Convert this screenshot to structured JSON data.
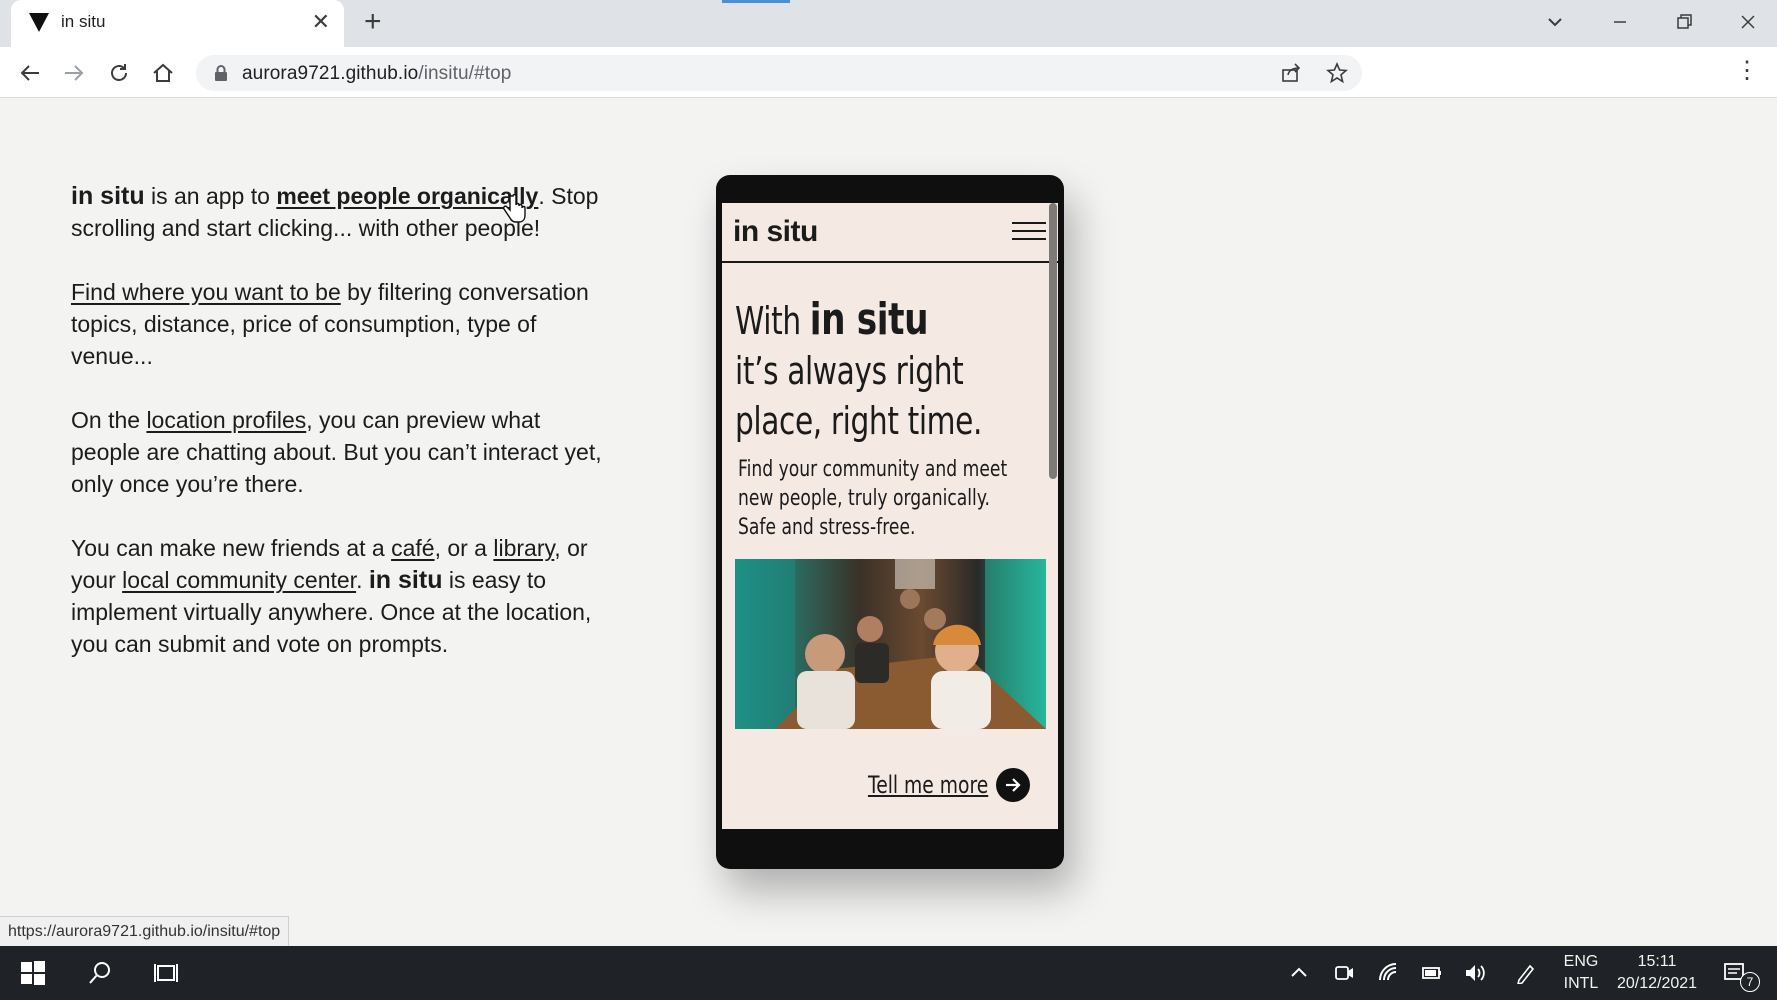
{
  "browser": {
    "tab_title": "in situ",
    "url_host": "aurora9721.github.io",
    "url_path": "/insitu/#top",
    "status_url": "https://aurora9721.github.io/insitu/#top",
    "accent_color": "#4a90d9"
  },
  "page": {
    "brand": "in situ",
    "p1": {
      "after_brand": " is an app to ",
      "link": "meet people organically",
      "rest": ". Stop scrolling and start clicking... with other people!"
    },
    "p2": {
      "link": "Find where you want to be",
      "rest": " by filtering conversation topics, distance, price of consumption, type of venue..."
    },
    "p3": {
      "before": "On the ",
      "link": "location profiles",
      "rest": ", you can preview what people are chatting about. But you can’t interact yet, only once you’re there."
    },
    "p4": {
      "t1": "You can make new friends at a ",
      "link_cafe": "café",
      "t2": ", or a ",
      "link_library": "library",
      "t3": ", or your ",
      "link_center": "local community center",
      "t4": ". ",
      "t5": " is easy to implement virtually anywhere. Once at the location, you can submit and vote on prompts."
    }
  },
  "phone": {
    "logo": "in situ",
    "headline_pre": "With ",
    "headline_brand": "in situ",
    "headline_rest": "it’s always right place, right time.",
    "subtext": "Find your community and meet new people, truly organically. Safe and stress-free.",
    "cta": "Tell me more"
  },
  "taskbar": {
    "lang_top": "ENG",
    "lang_bottom": "INTL",
    "time": "15:11",
    "date": "20/12/2021",
    "notifications": "7"
  }
}
